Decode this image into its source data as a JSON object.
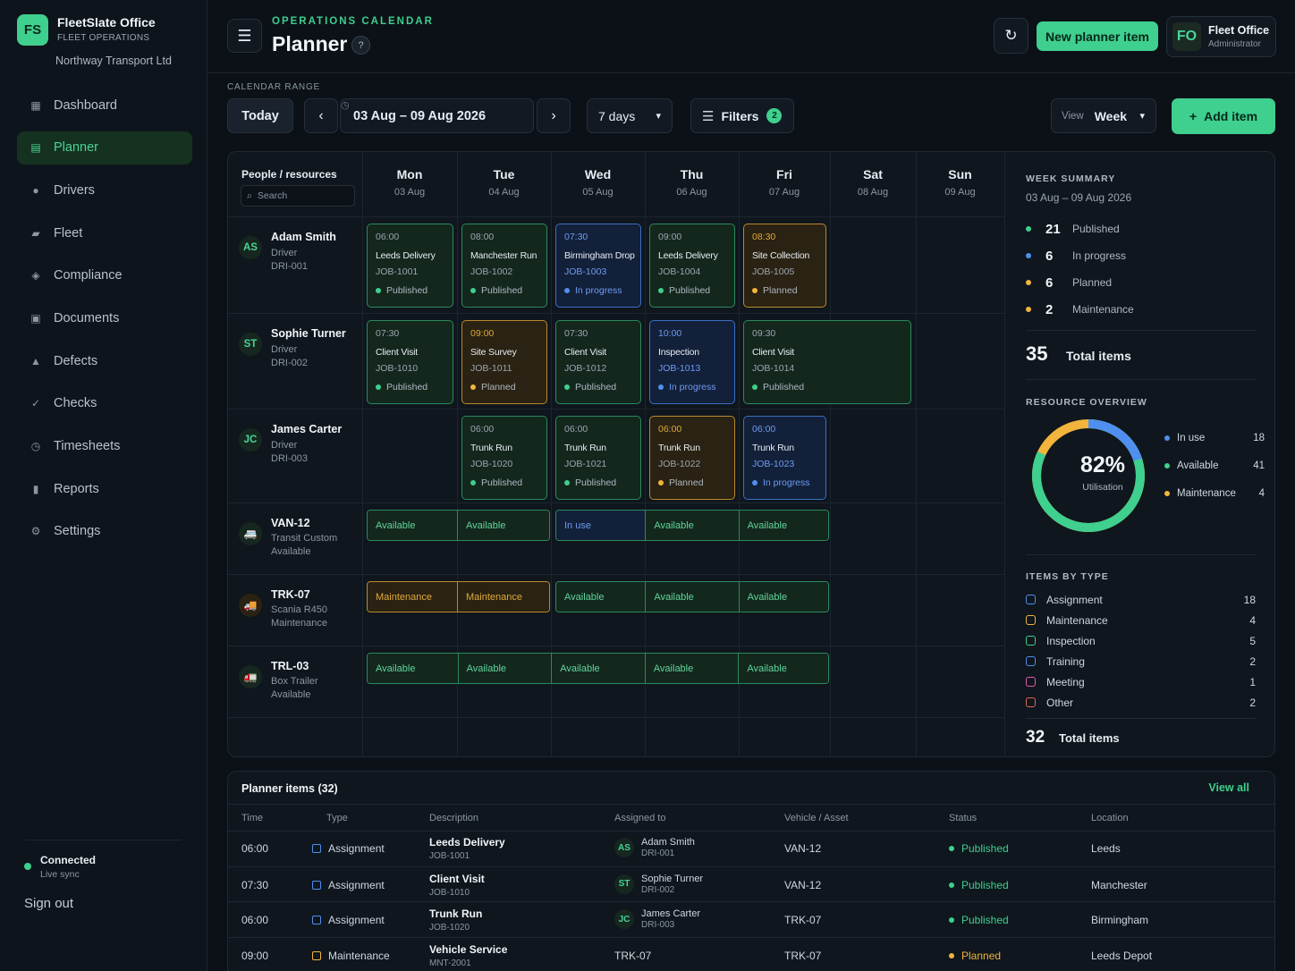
{
  "brand": {
    "logo": "FS",
    "name": "FleetSlate Office",
    "sub": "FLEET OPERATIONS",
    "org": "Northway Transport Ltd"
  },
  "nav": [
    {
      "label": "Dashboard",
      "icon": "▦"
    },
    {
      "label": "Planner",
      "icon": "▤",
      "active": true
    },
    {
      "label": "Drivers",
      "icon": "●"
    },
    {
      "label": "Fleet",
      "icon": "▰"
    },
    {
      "label": "Compliance",
      "icon": "◈"
    },
    {
      "label": "Documents",
      "icon": "▣"
    },
    {
      "label": "Defects",
      "icon": "▲"
    },
    {
      "label": "Checks",
      "icon": "✓"
    },
    {
      "label": "Timesheets",
      "icon": "◷"
    },
    {
      "label": "Reports",
      "icon": "▮"
    },
    {
      "label": "Settings",
      "icon": "⚙"
    }
  ],
  "connection": {
    "title": "Connected",
    "sub": "Live sync"
  },
  "signout": "Sign out",
  "header": {
    "eyebrow": "OPERATIONS CALENDAR",
    "title": "Planner",
    "help": "?",
    "new_item": "New planner item"
  },
  "user": {
    "initials": "FO",
    "name": "Fleet Office",
    "role": "Administrator"
  },
  "controls": {
    "range_label": "CALENDAR RANGE",
    "today": "Today",
    "range": "03 Aug – 09 Aug 2026",
    "days": "7 days",
    "filters": "Filters",
    "filter_count": "2",
    "view_label": "View",
    "view": "Week",
    "add_item": "Add item"
  },
  "grid": {
    "res_header": "People / resources",
    "search_placeholder": "Search",
    "days": [
      {
        "name": "Mon",
        "date": "03 Aug"
      },
      {
        "name": "Tue",
        "date": "04 Aug"
      },
      {
        "name": "Wed",
        "date": "05 Aug"
      },
      {
        "name": "Thu",
        "date": "06 Aug"
      },
      {
        "name": "Fri",
        "date": "07 Aug"
      },
      {
        "name": "Sat",
        "date": "08 Aug"
      },
      {
        "name": "Sun",
        "date": "09 Aug"
      }
    ],
    "people": [
      {
        "initials": "AS",
        "name": "Adam Smith",
        "role": "Driver",
        "id": "DRI-001",
        "items": [
          {
            "day": 0,
            "time": "06:00",
            "title": "Leeds Delivery",
            "job": "JOB-1001",
            "status": "Published",
            "kind": "pub"
          },
          {
            "day": 1,
            "time": "08:00",
            "title": "Manchester Run",
            "job": "JOB-1002",
            "status": "Published",
            "kind": "pub"
          },
          {
            "day": 2,
            "time": "07:30",
            "title": "Birmingham Drop",
            "job": "JOB-1003",
            "status": "In progress",
            "kind": "prog"
          },
          {
            "day": 3,
            "time": "09:00",
            "title": "Leeds Delivery",
            "job": "JOB-1004",
            "status": "Published",
            "kind": "pub"
          },
          {
            "day": 4,
            "time": "08:30",
            "title": "Site Collection",
            "job": "JOB-1005",
            "status": "Planned",
            "kind": "plan"
          }
        ]
      },
      {
        "initials": "ST",
        "name": "Sophie Turner",
        "role": "Driver",
        "id": "DRI-002",
        "items": [
          {
            "day": 0,
            "time": "07:30",
            "title": "Client Visit",
            "job": "JOB-1010",
            "status": "Published",
            "kind": "pub"
          },
          {
            "day": 1,
            "time": "09:00",
            "title": "Site Survey",
            "job": "JOB-1011",
            "status": "Planned",
            "kind": "plan"
          },
          {
            "day": 2,
            "time": "07:30",
            "title": "Client Visit",
            "job": "JOB-1012",
            "status": "Published",
            "kind": "pub"
          },
          {
            "day": 3,
            "time": "10:00",
            "title": "Inspection",
            "job": "JOB-1013",
            "status": "In progress",
            "kind": "prog"
          },
          {
            "day": 4,
            "time": "09:30",
            "title": "Client Visit",
            "job": "JOB-1014",
            "status": "Published",
            "kind": "pub",
            "wide": true
          }
        ]
      },
      {
        "initials": "JC",
        "name": "James Carter",
        "role": "Driver",
        "id": "DRI-003",
        "items": [
          {
            "day": 1,
            "time": "06:00",
            "title": "Trunk Run",
            "job": "JOB-1020",
            "status": "Published",
            "kind": "pub"
          },
          {
            "day": 2,
            "time": "06:00",
            "title": "Trunk Run",
            "job": "JOB-1021",
            "status": "Published",
            "kind": "pub"
          },
          {
            "day": 3,
            "time": "06:00",
            "title": "Trunk Run",
            "job": "JOB-1022",
            "status": "Planned",
            "kind": "plan"
          },
          {
            "day": 4,
            "time": "06:00",
            "title": "Trunk Run",
            "job": "JOB-1023",
            "status": "In progress",
            "kind": "prog"
          }
        ]
      }
    ],
    "vehicles": [
      {
        "name": "VAN-12",
        "model": "Transit Custom",
        "state": "Available",
        "icon": "🚐",
        "icolor": "#48d597",
        "ibg": "#16271f",
        "bars": [
          {
            "span": [
              0,
              2
            ],
            "kind": "av",
            "segs": [
              "Available",
              "Available"
            ]
          },
          {
            "span": [
              2,
              5
            ],
            "kind": "mix",
            "segs": [
              "In use",
              "Available",
              "Available"
            ]
          }
        ]
      },
      {
        "name": "TRK-07",
        "model": "Scania R450",
        "state": "Maintenance",
        "icon": "🚚",
        "icolor": "#f1b43c",
        "ibg": "#2a2212",
        "bars": [
          {
            "span": [
              0,
              2
            ],
            "kind": "mt",
            "segs": [
              "Maintenance",
              "Maintenance"
            ]
          },
          {
            "span": [
              2,
              5
            ],
            "kind": "av",
            "segs": [
              "Available",
              "Available",
              "Available"
            ]
          }
        ]
      },
      {
        "name": "TRL-03",
        "model": "Box Trailer",
        "state": "Available",
        "icon": "🚛",
        "icolor": "#48d597",
        "ibg": "#16271f",
        "bars": [
          {
            "span": [
              0,
              5
            ],
            "kind": "av",
            "segs": [
              "Available",
              "Available",
              "Available",
              "Available",
              "Available"
            ]
          }
        ]
      }
    ]
  },
  "summary": {
    "title": "WEEK SUMMARY",
    "range": "03 Aug – 09 Aug 2026",
    "stats": [
      {
        "n": "21",
        "label": "Published",
        "color": "#3fcf8e"
      },
      {
        "n": "6",
        "label": "In progress",
        "color": "#4f8fef"
      },
      {
        "n": "6",
        "label": "Planned",
        "color": "#f1b43c"
      },
      {
        "n": "2",
        "label": "Maintenance",
        "color": "#f1b43c"
      }
    ],
    "total_n": "35",
    "total_label": "Total items",
    "resource_title": "RESOURCE OVERVIEW",
    "util": "82%",
    "util_label": "Utilisation",
    "util_fraction": 0.82,
    "resources": [
      {
        "label": "In use",
        "value": "18",
        "color": "#4f8fef"
      },
      {
        "label": "Available",
        "value": "41",
        "color": "#3fcf8e"
      },
      {
        "label": "Maintenance",
        "value": "4",
        "color": "#f1b43c"
      }
    ],
    "types_title": "ITEMS BY TYPE",
    "types": [
      {
        "label": "Assignment",
        "value": "18",
        "color": "#4f8fef"
      },
      {
        "label": "Maintenance",
        "value": "4",
        "color": "#f1b43c"
      },
      {
        "label": "Inspection",
        "value": "5",
        "color": "#3fcf8e"
      },
      {
        "label": "Training",
        "value": "2",
        "color": "#4f8fef"
      },
      {
        "label": "Meeting",
        "value": "1",
        "color": "#e05ab0"
      },
      {
        "label": "Other",
        "value": "2",
        "color": "#e0665a"
      }
    ],
    "types_total_n": "32",
    "types_total_label": "Total items"
  },
  "table": {
    "title": "Planner items (32)",
    "view_all": "View all",
    "columns": [
      "Time",
      "Type",
      "Description",
      "Assigned to",
      "Vehicle / Asset",
      "Status",
      "Location"
    ],
    "rows": [
      {
        "time": "06:00",
        "type": "Assignment",
        "tcolor": "#4f8fef",
        "title": "Leeds Delivery",
        "job": "JOB-1001",
        "av": "AS",
        "person": "Adam Smith",
        "pid": "DRI-001",
        "vehicle": "VAN-12",
        "status": "Published",
        "scolor": "#3fcf8e",
        "location": "Leeds"
      },
      {
        "time": "07:30",
        "type": "Assignment",
        "tcolor": "#4f8fef",
        "title": "Client Visit",
        "job": "JOB-1010",
        "av": "ST",
        "person": "Sophie Turner",
        "pid": "DRI-002",
        "vehicle": "VAN-12",
        "status": "Published",
        "scolor": "#3fcf8e",
        "location": "Manchester"
      },
      {
        "time": "06:00",
        "type": "Assignment",
        "tcolor": "#4f8fef",
        "title": "Trunk Run",
        "job": "JOB-1020",
        "av": "JC",
        "person": "James Carter",
        "pid": "DRI-003",
        "vehicle": "TRK-07",
        "status": "Published",
        "scolor": "#3fcf8e",
        "location": "Birmingham"
      },
      {
        "time": "09:00",
        "type": "Maintenance",
        "tcolor": "#f1b43c",
        "title": "Vehicle Service",
        "job": "MNT-2001",
        "av": "",
        "person": "TRK-07",
        "pid": "",
        "vehicle": "TRK-07",
        "status": "Planned",
        "scolor": "#f1b43c",
        "location": "Leeds Depot"
      }
    ]
  }
}
